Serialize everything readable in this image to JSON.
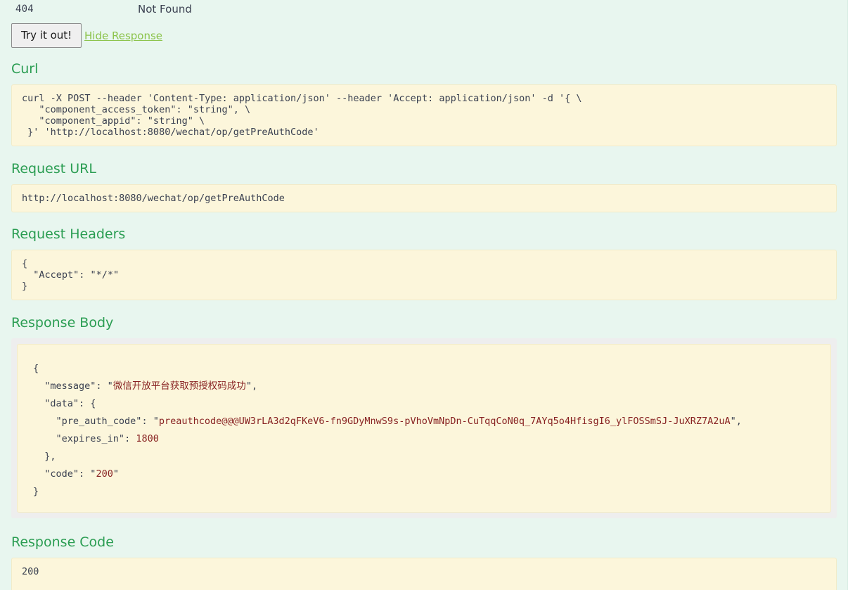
{
  "status": {
    "code": "404",
    "text": "Not Found"
  },
  "controls": {
    "try_label": "Try it out!",
    "hide_response_label": "Hide Response"
  },
  "colors": {
    "page_background": "#e8f6ef",
    "heading_green": "#2a9d52",
    "link_green": "#8bc34a",
    "code_background": "#fcf6db",
    "body_wrapper_grey": "#eeeeee",
    "json_string": "#882222",
    "text": "#3b4151"
  },
  "sections": {
    "curl": {
      "title": "Curl",
      "content": "curl -X POST --header 'Content-Type: application/json' --header 'Accept: application/json' -d '{ \\\n   \"component_access_token\": \"string\", \\\n   \"component_appid\": \"string\" \\\n }' 'http://localhost:8080/wechat/op/getPreAuthCode'"
    },
    "request_url": {
      "title": "Request URL",
      "content": "http://localhost:8080/wechat/op/getPreAuthCode"
    },
    "request_headers": {
      "title": "Request Headers",
      "content": "{\n  \"Accept\": \"*/*\"\n}"
    },
    "response_body": {
      "title": "Response Body",
      "json": {
        "message": "微信开放平台获取预授权码成功",
        "data": {
          "pre_auth_code": "preauthcode@@@UW3rLA3d2qFKeV6-fn9GDyMnwS9s-pVhoVmNpDn-CuTqqCoN0q_7AYq5o4HfisgI6_ylFOSSmSJ-JuXRZ7A2uA",
          "expires_in": "1800"
        },
        "code": "200"
      },
      "keys": {
        "message": "\"message\"",
        "data": "\"data\"",
        "pre_auth_code": "\"pre_auth_code\"",
        "expires_in": "\"expires_in\"",
        "code": "\"code\""
      }
    },
    "response_code": {
      "title": "Response Code",
      "content": "200"
    }
  }
}
